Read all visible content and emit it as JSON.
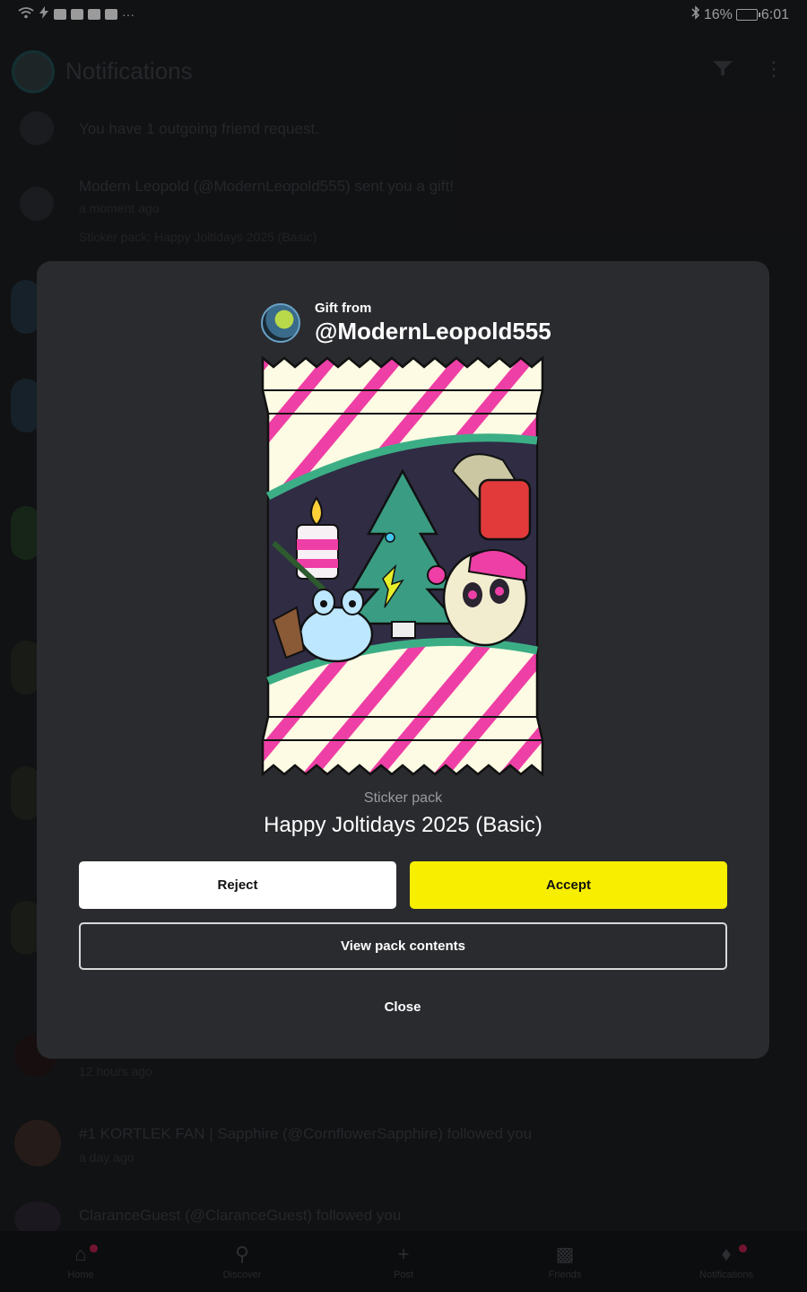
{
  "status_bar": {
    "left_more": "···",
    "battery": "16%",
    "time": "6:01"
  },
  "background": {
    "header_title": "Notifications",
    "rows": [
      {
        "text": "You have 1 outgoing friend request."
      },
      {
        "text": "Modern Leopold (@ModernLeopold555) sent you a gift!",
        "sub": "a moment ago",
        "detail": "Sticker pack: Happy Joltidays 2025 (Basic)"
      },
      {
        "sub": "12 hours ago"
      },
      {
        "text": "#1 KORTLEK FAN | Sapphire (@CornflowerSapphire) followed you",
        "sub": "a day ago"
      },
      {
        "text": "ClaranceGuest (@ClaranceGuest) followed you"
      }
    ],
    "nav": [
      "Home",
      "Discover",
      "Post",
      "Friends",
      "Notifications"
    ]
  },
  "modal": {
    "gift_from_label": "Gift from",
    "sender": "@ModernLeopold555",
    "pack_type": "Sticker pack",
    "pack_name": "Happy Joltidays 2025 (Basic)",
    "reject_label": "Reject",
    "accept_label": "Accept",
    "view_label": "View pack contents",
    "close_label": "Close"
  },
  "colors": {
    "accent": "#f7ee00",
    "modal_bg": "#2a2b2f",
    "page_bg": "#1b1c20",
    "stripe_pink": "#ee3fa6",
    "wrapper_cream": "#fdfbe3"
  }
}
